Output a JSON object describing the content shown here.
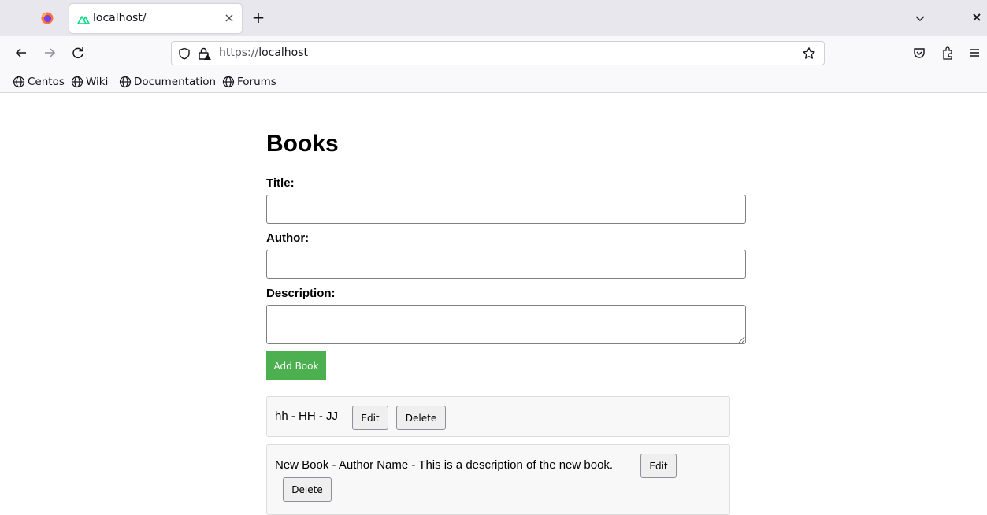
{
  "browser": {
    "tab": {
      "title": "localhost/",
      "close_glyph": "×"
    },
    "new_tab_glyph": "+",
    "window_close_glyph": "×",
    "url": {
      "scheme": "https://",
      "host": "localhost"
    },
    "bookmarks": [
      {
        "label": "Centos",
        "icon": "globe-icon"
      },
      {
        "label": "Wiki",
        "icon": "globe-icon"
      },
      {
        "label": "Documentation",
        "icon": "globe-icon"
      },
      {
        "label": "Forums",
        "icon": "globe-icon"
      }
    ]
  },
  "page": {
    "title": "Books",
    "form": {
      "title_label": "Title:",
      "title_value": "",
      "author_label": "Author:",
      "author_value": "",
      "description_label": "Description:",
      "description_value": "",
      "add_button": "Add Book"
    },
    "books": [
      {
        "text": "hh - HH - JJ",
        "edit": "Edit",
        "delete": "Delete"
      },
      {
        "text": "New Book - Author Name - This is a description of the new book.",
        "edit": "Edit",
        "delete": "Delete"
      }
    ]
  },
  "colors": {
    "accent_green": "#4caf50",
    "tab_strip": "#e9e7ee",
    "toolbar": "#f9f9fb"
  }
}
